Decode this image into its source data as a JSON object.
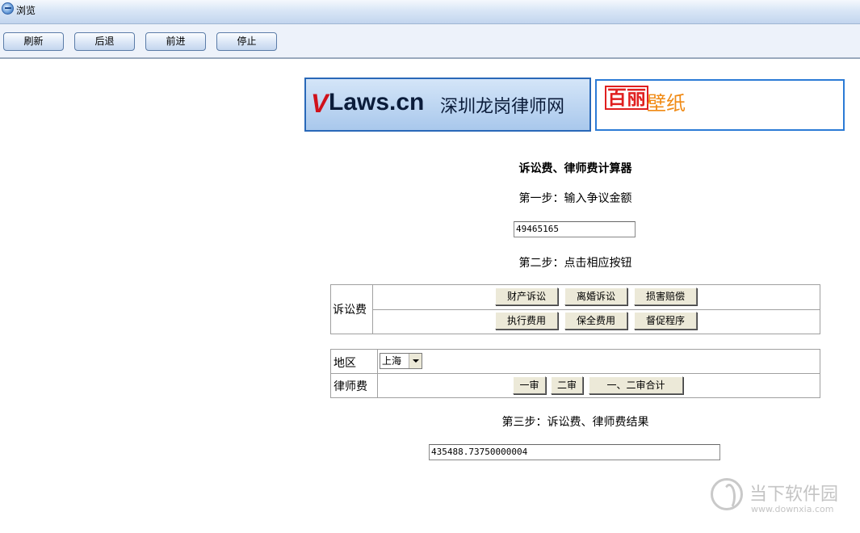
{
  "window": {
    "title": "浏览",
    "icon": "browser-globe-icon"
  },
  "toolbar": {
    "refresh": "刷新",
    "back": "后退",
    "forward": "前进",
    "stop": "停止"
  },
  "banners": {
    "left": {
      "logo_v": "V",
      "logo_text": "Laws.cn",
      "subtitle": "深圳龙岗律师网"
    },
    "right": {
      "part1": "百丽",
      "part2": "壁纸"
    }
  },
  "calculator": {
    "heading": "诉讼费、律师费计算器",
    "step1": "第一步：输入争议金额",
    "amount_value": "49465165",
    "step2": "第二步：点击相应按钮",
    "litigation": {
      "label": "诉讼费",
      "row1": [
        "财产诉讼",
        "离婚诉讼",
        "损害赔偿"
      ],
      "row2": [
        "执行费用",
        "保全费用",
        "督促程序"
      ]
    },
    "lawyer": {
      "region_label": "地区",
      "region_value": "上海",
      "fee_label": "律师费",
      "buttons": [
        "一审",
        "二审",
        "一、二审合计"
      ]
    },
    "step3": "第三步：诉讼费、律师费结果",
    "result_value": "435488.73750000004"
  },
  "watermark": {
    "name": "当下软件园",
    "url": "www.downxia.com"
  }
}
